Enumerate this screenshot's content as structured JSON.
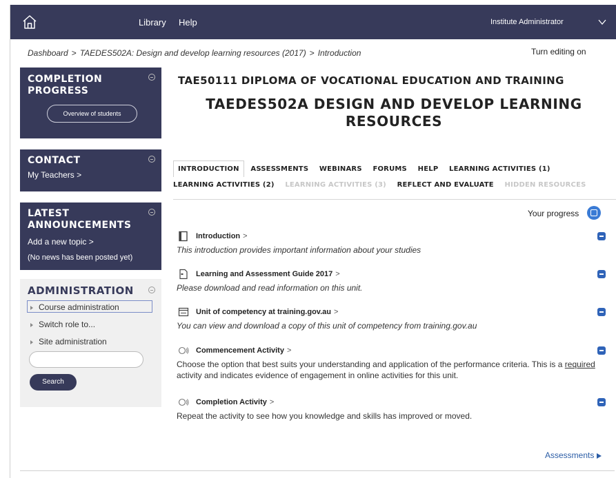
{
  "nav": {
    "library": "Library",
    "help": "Help",
    "user": "Institute Administrator"
  },
  "breadcrumb": {
    "items": [
      "Dashboard",
      "TAEDES502A: Design and develop learning resources (2017)",
      "Introduction"
    ],
    "separator": ">"
  },
  "turn_editing": "Turn editing on",
  "sidebar": {
    "completion": {
      "title": "COMPLETION PROGRESS",
      "button": "Overview of students"
    },
    "contact": {
      "title": "CONTACT",
      "link": "My Teachers"
    },
    "announcements": {
      "title": "LATEST ANNOUNCEMENTS",
      "link": "Add a new topic",
      "note": "(No news has been posted yet)"
    },
    "administration": {
      "title": "ADMINISTRATION",
      "items": [
        "Course administration",
        "Switch role to...",
        "Site administration"
      ],
      "search_placeholder": "",
      "search_button": "Search"
    }
  },
  "course": {
    "line1": "TAE50111 DIPLOMA OF VOCATIONAL EDUCATION AND TRAINING",
    "line2": "TAEDES502A DESIGN AND DEVELOP LEARNING RESOURCES"
  },
  "tabs": {
    "row1": [
      "INTRODUCTION",
      "ASSESSMENTS",
      "WEBINARS",
      "FORUMS",
      "HELP",
      "LEARNING ACTIVITIES (1)"
    ],
    "row2": [
      "LEARNING ACTIVITIES (2)",
      "LEARNING ACTIVITIES (3)",
      "REFLECT AND EVALUATE",
      "HIDDEN RESOURCES"
    ]
  },
  "progress_label": "Your progress",
  "activities": [
    {
      "title": "Introduction",
      "desc": "This introduction provides important information about your studies",
      "icon": "book-icon"
    },
    {
      "title": "Learning and Assessment Guide 2017",
      "desc": "Please download and read information on this unit.",
      "icon": "document-icon"
    },
    {
      "title": "Unit of competency at training.gov.au",
      "desc": "You can view and download a copy of this unit of competency from training.gov.au",
      "icon": "window-icon"
    },
    {
      "title": "Commencement Activity",
      "desc_pre": "Choose the option that best suits your understanding and application of the performance criteria. This is a ",
      "desc_underline": "required",
      "desc_post": " activity and indicates evidence of engagement in online activities for this unit.",
      "icon": "feedback-icon"
    },
    {
      "title": "Completion Activity",
      "desc": "Repeat the activity to see how you knowledge and skills has improved or moved.",
      "icon": "feedback-icon"
    }
  ],
  "chevron": ">",
  "next_section": "Assessments",
  "colors": {
    "nav_bg": "#373a5a",
    "accent": "#2f63b8",
    "link": "#2b5da6"
  }
}
